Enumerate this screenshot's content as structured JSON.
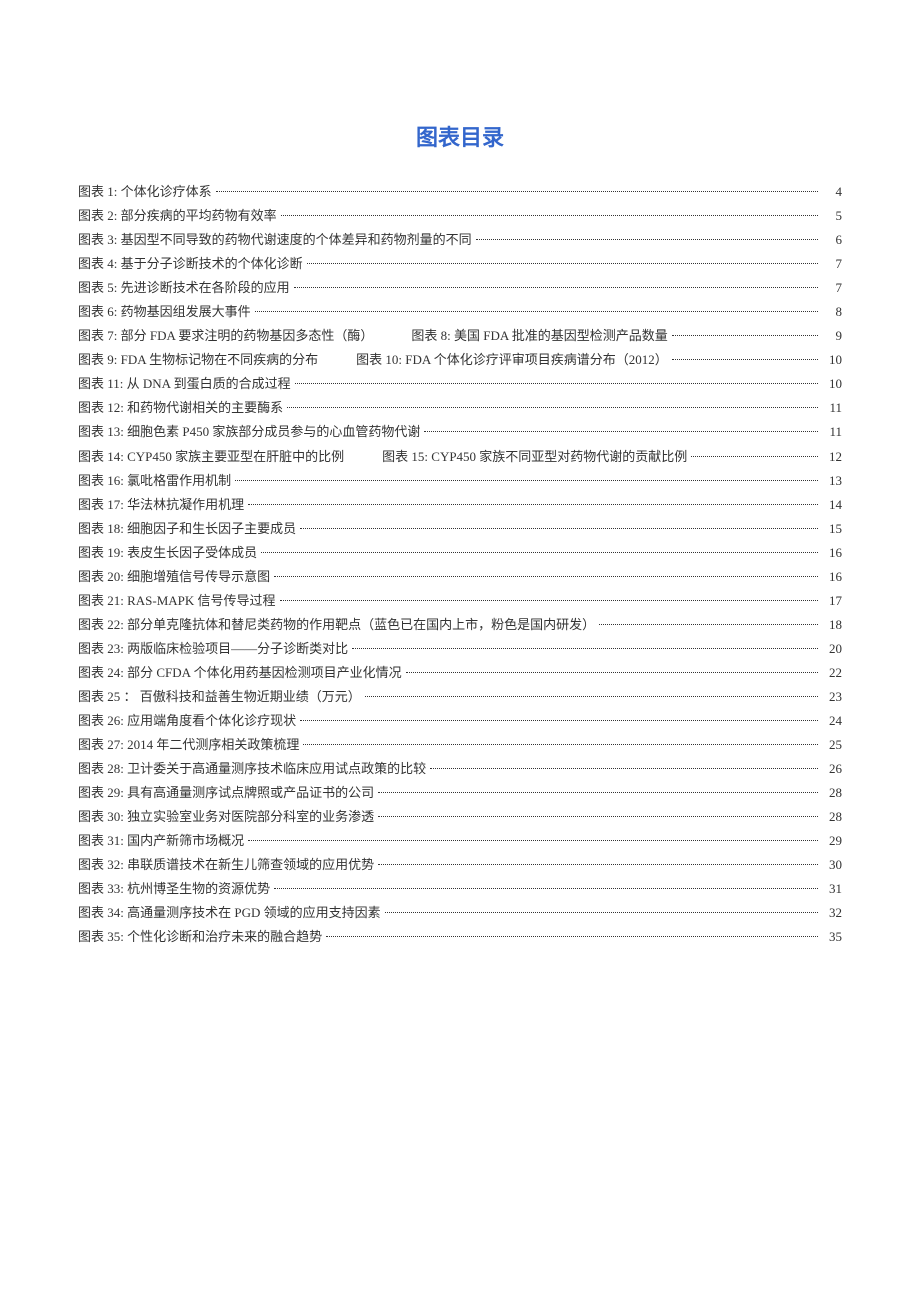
{
  "title": "图表目录",
  "entries": [
    {
      "label": "图表 1: 个体化诊疗体系",
      "page": "4"
    },
    {
      "label": "图表 2: 部分疾病的平均药物有效率",
      "page": "5"
    },
    {
      "label": "图表 3: 基因型不同导致的药物代谢速度的个体差异和药物剂量的不同",
      "page": "6"
    },
    {
      "label": "图表 4: 基于分子诊断技术的个体化诊断",
      "page": "7"
    },
    {
      "label": "图表 5: 先进诊断技术在各阶段的应用",
      "page": "7"
    },
    {
      "label": "图表 6: 药物基因组发展大事件",
      "page": "8"
    },
    {
      "label": "图表 7: 部分 FDA 要求注明的药物基因多态性（酶）",
      "second": "图表 8: 美国 FDA 批准的基因型检测产品数量",
      "page": "9"
    },
    {
      "label": "图表 9: FDA 生物标记物在不同疾病的分布",
      "second": "图表 10: FDA 个体化诊疗评审项目疾病谱分布（2012）",
      "page": "10"
    },
    {
      "label": "图表 11: 从 DNA 到蛋白质的合成过程",
      "page": "10"
    },
    {
      "label": "图表 12: 和药物代谢相关的主要酶系",
      "page": "11"
    },
    {
      "label": "图表 13: 细胞色素 P450 家族部分成员参与的心血管药物代谢",
      "page": "11"
    },
    {
      "label": "图表 14: CYP450 家族主要亚型在肝脏中的比例",
      "second": "图表 15: CYP450 家族不同亚型对药物代谢的贡献比例",
      "page": "12"
    },
    {
      "label": "图表 16: 氯吡格雷作用机制",
      "page": "13"
    },
    {
      "label": "图表 17: 华法林抗凝作用机理",
      "page": "14"
    },
    {
      "label": "图表 18: 细胞因子和生长因子主要成员",
      "page": "15"
    },
    {
      "label": "图表 19: 表皮生长因子受体成员",
      "page": "16"
    },
    {
      "label": "图表 20: 细胞增殖信号传导示意图",
      "page": "16"
    },
    {
      "label": "图表 21: RAS-MAPK 信号传导过程",
      "page": "17"
    },
    {
      "label": "图表 22: 部分单克隆抗体和替尼类药物的作用靶点（蓝色已在国内上市，粉色是国内研发）",
      "page": "18"
    },
    {
      "label": "图表 23: 两版临床检验项目——分子诊断类对比",
      "page": "20"
    },
    {
      "label": "图表 24: 部分 CFDA 个体化用药基因检测项目产业化情况",
      "page": "22"
    },
    {
      "label": "图表 25 ： 百傲科技和益善生物近期业绩（万元）",
      "page": "23"
    },
    {
      "label": "图表 26: 应用端角度看个体化诊疗现状",
      "page": "24"
    },
    {
      "label": "图表 27: 2014 年二代测序相关政策梳理",
      "page": "25"
    },
    {
      "label": "图表 28: 卫计委关于高通量测序技术临床应用试点政策的比较",
      "page": "26"
    },
    {
      "label": "图表 29: 具有高通量测序试点牌照或产品证书的公司",
      "page": "28"
    },
    {
      "label": "图表 30: 独立实验室业务对医院部分科室的业务渗透",
      "page": "28"
    },
    {
      "label": "图表 31: 国内产新筛市场概况",
      "page": "29"
    },
    {
      "label": "图表 32: 串联质谱技术在新生儿筛查领域的应用优势",
      "page": "30"
    },
    {
      "label": "图表 33: 杭州博圣生物的资源优势",
      "page": "31"
    },
    {
      "label": "图表 34: 高通量测序技术在 PGD 领域的应用支持因素",
      "page": "32"
    },
    {
      "label": "图表 35: 个性化诊断和治疗未来的融合趋势",
      "page": "35"
    }
  ]
}
